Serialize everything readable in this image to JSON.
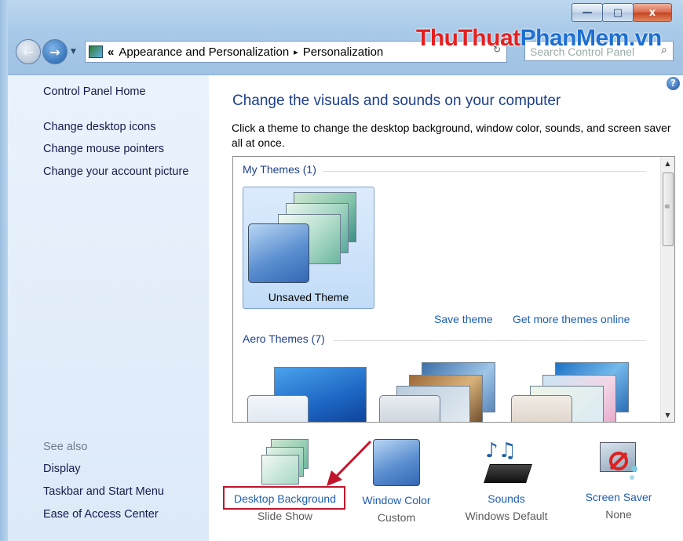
{
  "window": {
    "minimize_glyph": "—",
    "maximize_glyph": "□",
    "close_glyph": "x"
  },
  "address": {
    "overflow": "«",
    "crumb1": "Appearance and Personalization",
    "separator": "▸",
    "crumb2": "Personalization"
  },
  "search": {
    "placeholder": "Search Control Panel"
  },
  "watermark": {
    "part1": "ThuThuat",
    "part2": "PhanMem.vn"
  },
  "sidebar": {
    "home": "Control Panel Home",
    "items": [
      "Change desktop icons",
      "Change mouse pointers",
      "Change your account picture"
    ],
    "see_also_header": "See also",
    "see_also": [
      "Display",
      "Taskbar and Start Menu",
      "Ease of Access Center"
    ]
  },
  "main": {
    "help_glyph": "?",
    "title": "Change the visuals and sounds on your computer",
    "description": "Click a theme to change the desktop background, window color, sounds, and screen saver all at once.",
    "my_themes_header": "My Themes (1)",
    "unsaved_theme_label": "Unsaved Theme",
    "save_theme": "Save theme",
    "get_more_themes": "Get more themes online",
    "aero_themes_header": "Aero Themes (7)"
  },
  "bottom": {
    "desktop_background": {
      "label": "Desktop Background",
      "value": "Slide Show"
    },
    "window_color": {
      "label": "Window Color",
      "value": "Custom"
    },
    "sounds": {
      "label": "Sounds",
      "value": "Windows Default"
    },
    "screen_saver": {
      "label": "Screen Saver",
      "value": "None"
    }
  },
  "colors": {
    "link": "#1e5eb3",
    "heading": "#1e3f8a",
    "annotation_red": "#c0162d",
    "sidebar_bg": "#e4eefb"
  }
}
